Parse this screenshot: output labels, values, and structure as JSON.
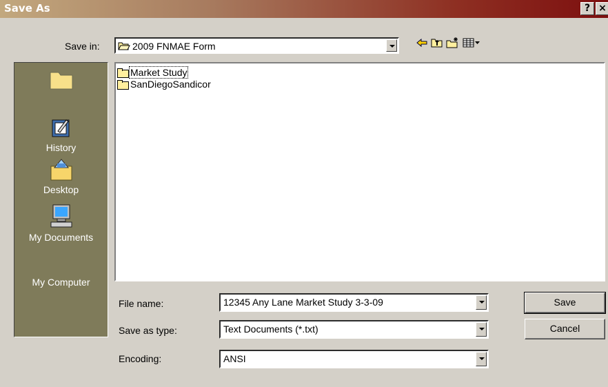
{
  "window": {
    "title": "Save As",
    "help_label": "?",
    "close_label": "×"
  },
  "save_in": {
    "label": "Save in:",
    "value": "2009 FNMAE Form"
  },
  "toolbar": {
    "icons": [
      "back-arrow-icon",
      "up-folder-icon",
      "new-folder-icon",
      "view-menu-icon"
    ]
  },
  "places": [
    {
      "label": "",
      "icon": "folder-icon"
    },
    {
      "label": "History",
      "icon": "history-icon"
    },
    {
      "label": "Desktop",
      "icon": "desktop-icon"
    },
    {
      "label": "My Documents",
      "icon": "my-documents-icon"
    },
    {
      "label": "My Computer",
      "icon": "my-computer-icon"
    }
  ],
  "files": [
    {
      "name": "Market Study"
    },
    {
      "name": "SanDiegoSandicor"
    }
  ],
  "file_name": {
    "label": "File name:",
    "value": "12345 Any Lane Market Study 3-3-09"
  },
  "save_type": {
    "label": "Save as type:",
    "value": "Text Documents (*.txt)"
  },
  "encoding": {
    "label": "Encoding:",
    "value": "ANSI"
  },
  "buttons": {
    "save": "Save",
    "cancel": "Cancel"
  },
  "colors": {
    "sidebar": "#7f7b5a",
    "dialog": "#d4d0c8",
    "title_start": "#c2a87e",
    "title_end": "#7d0f0f"
  }
}
